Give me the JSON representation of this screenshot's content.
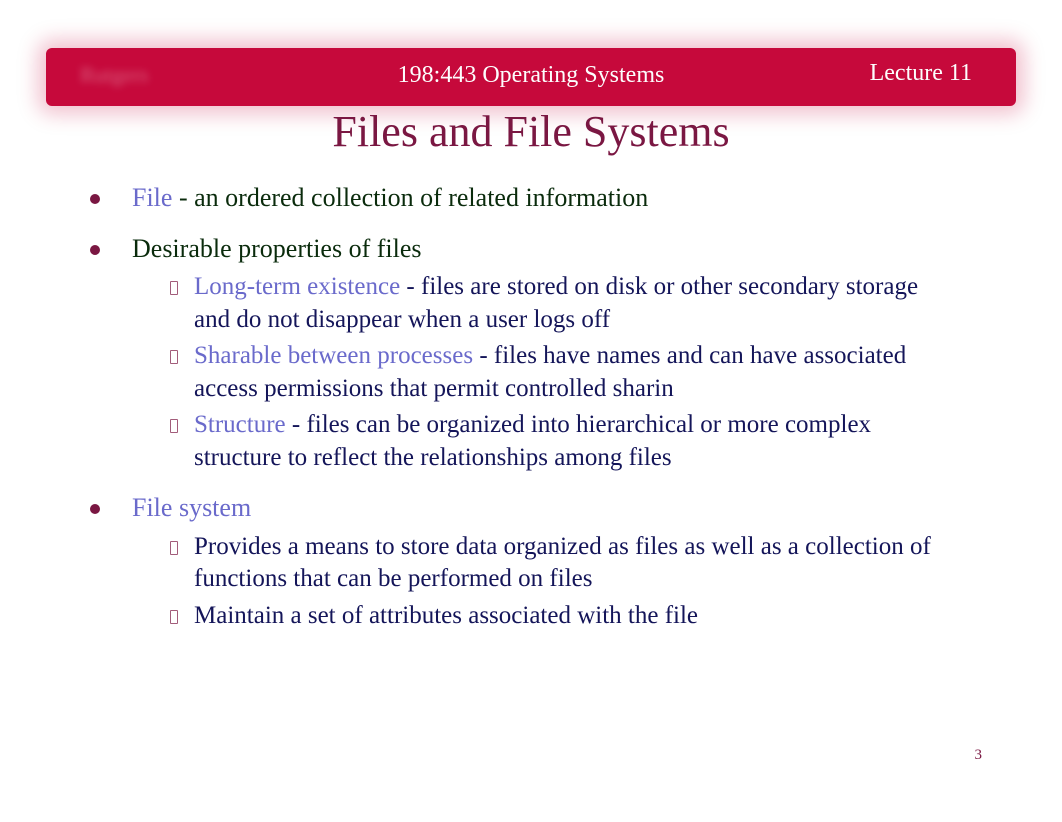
{
  "header": {
    "blur_label": "Rutgers",
    "course": "198:443 Operating Systems",
    "lecture": "Lecture 11"
  },
  "title": "Files and File Systems",
  "bullets": {
    "b1": {
      "term": "File",
      "sep": " - ",
      "desc": "an ordered collection of related information"
    },
    "b2": {
      "heading": "Desirable properties of files",
      "s1": {
        "term": "Long-term existence",
        "rest": "  - files are stored on disk or other secondary storage and do not disappear when a user logs off"
      },
      "s2": {
        "term": " Sharable between processes",
        "rest": "    - files have names and can have associated access permissions that permit controlled sharin"
      },
      "s3": {
        "term": "Structure",
        "rest": "  - files can be organized into hierarchical or more complex structure to reflect the relationships among files"
      }
    },
    "b3": {
      "term": "File system",
      "s1": "Provides a means to store data organized as files as well as a collection of functions that can be performed on files",
      "s2": "Maintain a set of attributes associated with the file"
    }
  },
  "page_number": "3"
}
